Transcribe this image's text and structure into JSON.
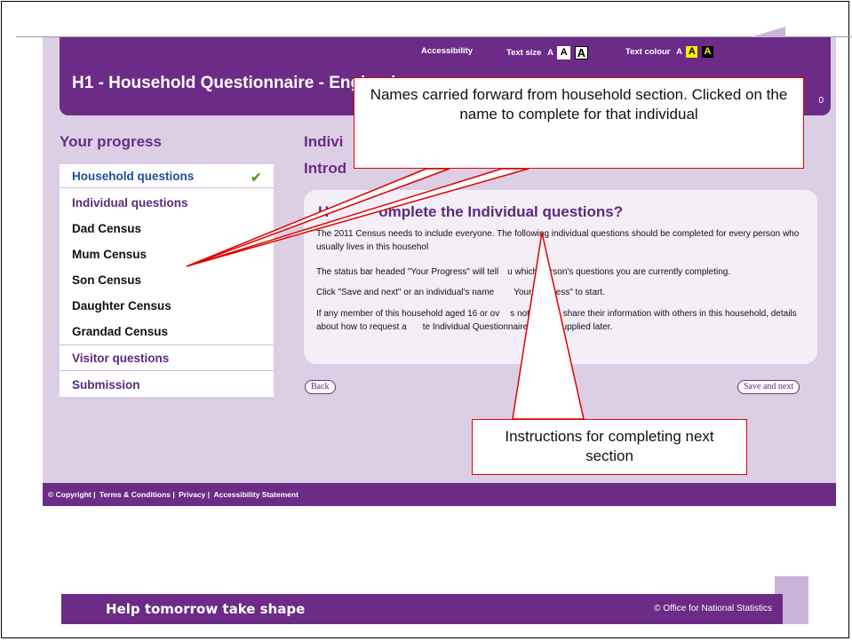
{
  "header": {
    "accessibility_link": "Accessibility",
    "text_size_label": "Text size",
    "text_size_a_small": "A",
    "text_size_a_medium": "A",
    "text_size_a_large": "A",
    "text_colour_label": "Text colour",
    "text_colour_a_default": "A",
    "text_colour_a_yellow": "A",
    "text_colour_a_black": "A",
    "title": "H1 - Household Questionnaire - England",
    "right_fragment": "0"
  },
  "progress": {
    "heading": "Your progress",
    "items": [
      {
        "label": "Household questions",
        "state": "complete"
      },
      {
        "label": "Individual questions",
        "state": "current"
      },
      {
        "label": "Dad Census",
        "state": "person"
      },
      {
        "label": "Mum Census",
        "state": "person"
      },
      {
        "label": "Son Census",
        "state": "person"
      },
      {
        "label": "Daughter Census",
        "state": "person"
      },
      {
        "label": "Grandad Census",
        "state": "person"
      },
      {
        "label": "Visitor questions",
        "state": "section"
      },
      {
        "label": "Submission",
        "state": "section"
      }
    ]
  },
  "main": {
    "heading_line1": "Indivi",
    "heading_line2": "Introd",
    "info_heading_start": "H",
    "info_heading_end": "omplete the Individual questions?",
    "paragraphs": [
      "The 2011 Census needs to include everyone. The following individual questions should be completed for every person who usually lives in this househol",
      "The status bar headed \"Your Progress\" will tell",
      "u which person's questions you are currently completing.",
      "Click \"Save and next\" or an individual's name",
      "Your Progress\" to start.",
      "If any member of this household aged 16 or ov",
      "s not want to share their information with others in this household, details about how to request a",
      "te Individual Questionnaire will be supplied later."
    ],
    "back_button": "Back",
    "save_next_button": "Save and next"
  },
  "footer": {
    "copyright": "© Copyright",
    "terms": "Terms & Conditions",
    "privacy": "Privacy",
    "accessibility": "Accessibility Statement"
  },
  "banner": {
    "slogan": "Help tomorrow take shape",
    "owner": "© Office for National Statistics"
  },
  "callouts": {
    "names": "Names carried forward from household section.  Clicked on the name to complete for that individual",
    "instructions": "Instructions for completing next section"
  },
  "colors": {
    "brand_purple": "#6b2b86",
    "page_lilac": "#dccfe5",
    "callout_red": "#e00000",
    "check_green": "#5aa02c"
  }
}
